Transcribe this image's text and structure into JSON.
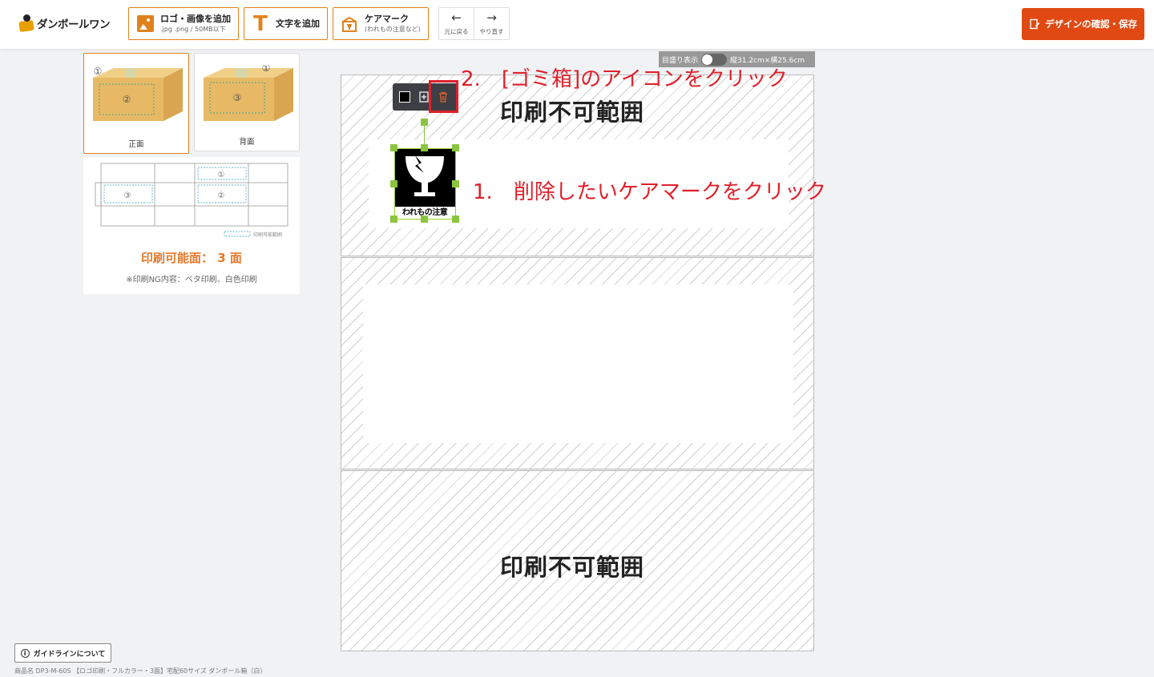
{
  "header": {
    "logo_text": "ダンボールワン",
    "add_logo": {
      "label": "ロゴ・画像を追加",
      "sub": ".jpg .png / 50MB以下"
    },
    "add_text": {
      "label": "文字を追加"
    },
    "care_mark": {
      "label": "ケアマーク",
      "sub": "(われもの注意など)"
    },
    "undo": {
      "icon": "←",
      "label": "元に戻る"
    },
    "redo": {
      "icon": "→",
      "label": "やり直す"
    },
    "save_label": "デザインの確認・保存",
    "accent_color": "#e04a12"
  },
  "faces": [
    {
      "label": "正面",
      "box_numbers": [
        "①",
        "②"
      ],
      "active": true
    },
    {
      "label": "背面",
      "box_numbers": [
        "①",
        "③"
      ],
      "active": false
    }
  ],
  "diagram": {
    "legend": "印刷可能範囲",
    "numbers": [
      "①",
      "②",
      "③"
    ],
    "print_faces": "印刷可能面： 3 面",
    "ng_note": "※印刷NG内容：ベタ印刷、白色印刷"
  },
  "canvas": {
    "ruler_label": "目盛り表示",
    "dimensions": "縦31.2cm×横25.6cm",
    "nonprint_top": "印刷不可範囲",
    "nonprint_bottom": "印刷不可範囲",
    "care_mark_caption": "われもの注意"
  },
  "annotations": {
    "step2_num": "2.",
    "step2_text": "[ゴミ箱]のアイコンをクリック",
    "step1_num": "1.",
    "step1_text": "削除したいケアマークをクリック"
  },
  "footer": {
    "guide_label": "ガイドラインについて",
    "product_name": "商品名 DP3-M-60S 【ロゴ印刷・フルカラー・3面】宅配60サイズ ダンボール箱（白）"
  }
}
